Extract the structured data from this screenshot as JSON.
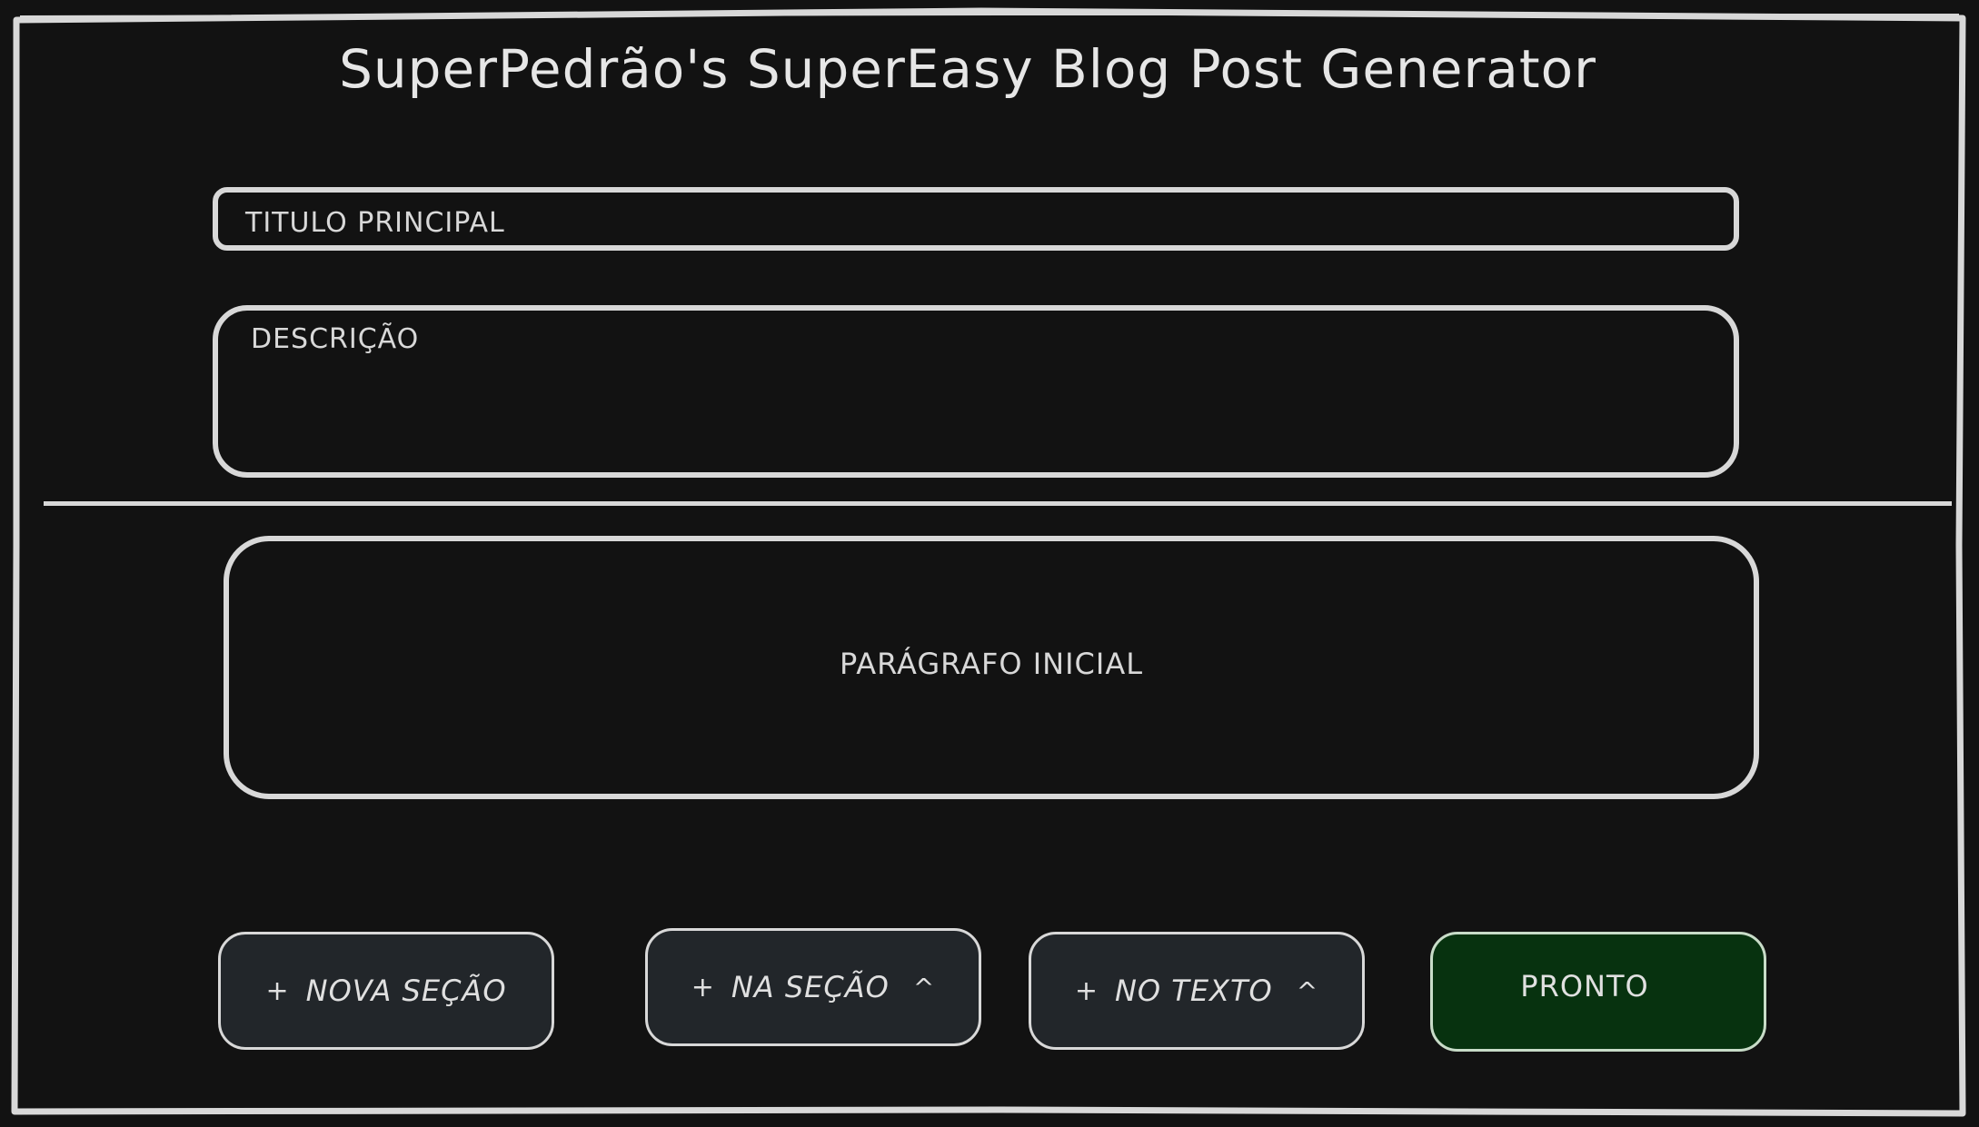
{
  "app": {
    "title": "SuperPedrão's SuperEasy Blog Post Generator"
  },
  "form": {
    "title_placeholder": "TITULO PRINCIPAL",
    "description_placeholder": "DESCRIÇÃO",
    "paragraph_placeholder": "PARÁGRAFO INICIAL"
  },
  "actions": {
    "plus_glyph": "+",
    "caret_glyph": "^",
    "nova_secao_label": "NOVA SEÇÃO",
    "na_secao_label": "NA SEÇÃO",
    "no_texto_label": "NO TEXTO",
    "pronto_label": "PRONTO"
  },
  "colors": {
    "background": "#121212",
    "stroke": "#d8d8d8",
    "button_fill": "#22262a",
    "pronto_fill": "#07320f"
  }
}
